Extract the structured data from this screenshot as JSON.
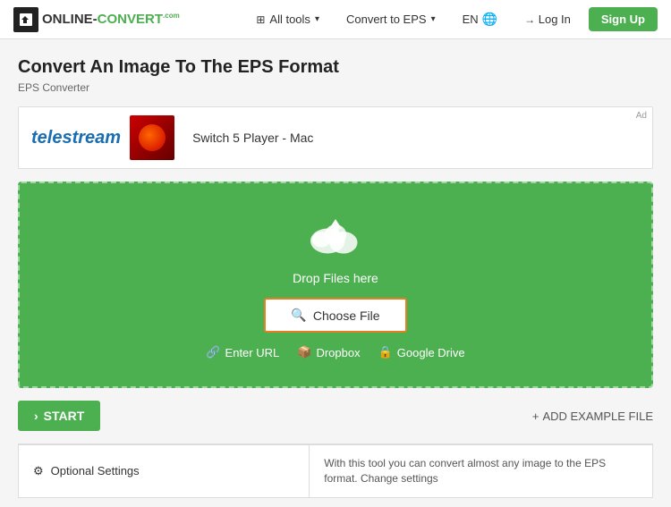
{
  "header": {
    "logo_text": "ONLINE-CONVERT",
    "logo_com": ".COM",
    "all_tools_label": "All tools",
    "convert_to_eps_label": "Convert to EPS",
    "lang_label": "EN",
    "login_label": "Log In",
    "signup_label": "Sign Up"
  },
  "page": {
    "title": "Convert An Image To The EPS Format",
    "subtitle": "EPS Converter"
  },
  "ad": {
    "label": "Ad",
    "brand": "telestream",
    "product_text": "Switch 5 Player - Mac"
  },
  "upload": {
    "drop_text": "Drop Files here",
    "choose_file_label": "Choose File",
    "enter_url_label": "Enter URL",
    "dropbox_label": "Dropbox",
    "google_drive_label": "Google Drive"
  },
  "actions": {
    "start_label": "START",
    "add_example_label": "ADD EXAMPLE FILE"
  },
  "bottom": {
    "optional_settings_label": "Optional Settings",
    "info_text": "With this tool you can convert almost any image to the EPS format. Change settings"
  }
}
